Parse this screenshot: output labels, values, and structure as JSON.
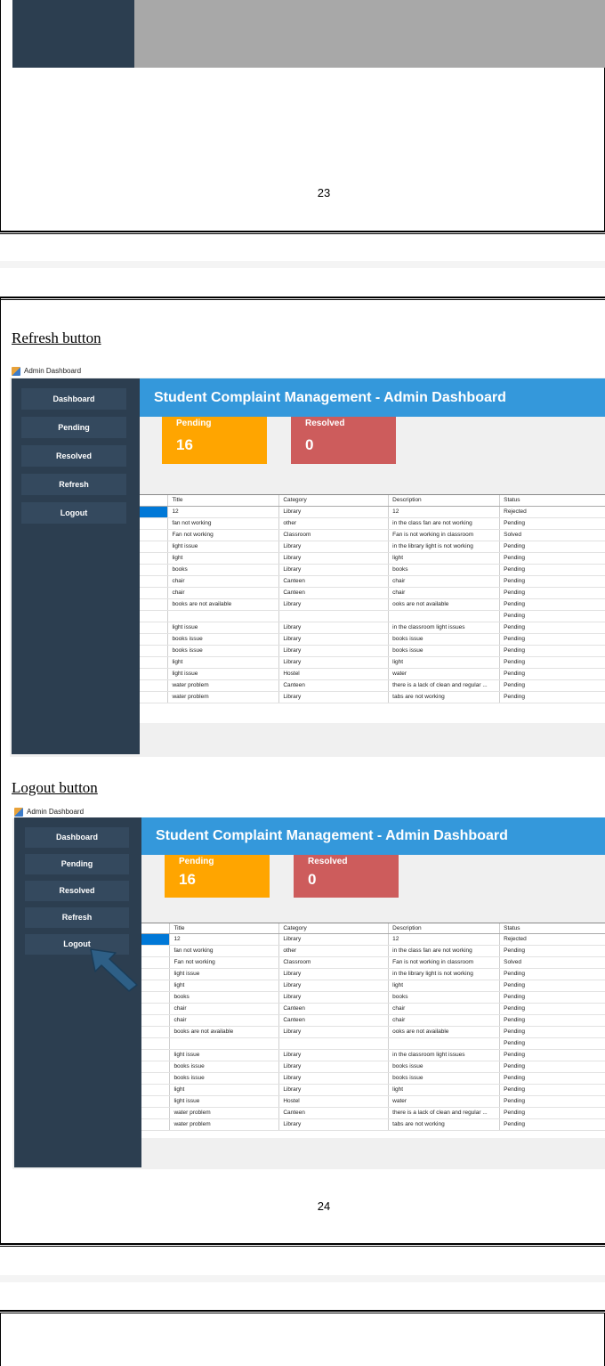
{
  "page_top": {
    "page_number": "23"
  },
  "page_main": {
    "refresh_heading": "Refresh button",
    "logout_heading": "Logout button",
    "page_number": "24"
  },
  "screens": [
    {
      "window_title": "Admin Dashboard",
      "banner": "Student Complaint Management - Admin Dashboard",
      "nav": [
        "Dashboard",
        "Pending",
        "Resolved",
        "Refresh",
        "Logout"
      ],
      "cards": [
        {
          "label": "Pending",
          "value": "16",
          "color": "#ffa500"
        },
        {
          "label": "Resolved",
          "value": "0",
          "color": "#cd5c5c"
        }
      ]
    },
    {
      "window_title": "Admin Dashboard",
      "banner": "Student Complaint Management - Admin Dashboard",
      "nav": [
        "Dashboard",
        "Pending",
        "Resolved",
        "Refresh",
        "Logout"
      ],
      "cards": [
        {
          "label": "Pending",
          "value": "16",
          "color": "#ffa500"
        },
        {
          "label": "Resolved",
          "value": "0",
          "color": "#cd5c5c"
        }
      ]
    }
  ],
  "table": {
    "columns": [
      "Title",
      "Category",
      "Description",
      "Status"
    ],
    "rows": [
      [
        "12",
        "Library",
        "12",
        "Rejected"
      ],
      [
        "fan not working",
        "other",
        "in the class fan are not working",
        "Pending"
      ],
      [
        "Fan not working",
        "Classroom",
        "Fan is not working in classroom",
        "Solved"
      ],
      [
        "light issue",
        "Library",
        "in the library light is not working",
        "Pending"
      ],
      [
        "light",
        "Library",
        "light",
        "Pending"
      ],
      [
        "books",
        "Library",
        "books",
        "Pending"
      ],
      [
        "chair",
        "Canteen",
        "chair",
        "Pending"
      ],
      [
        "chair",
        "Canteen",
        "chair",
        "Pending"
      ],
      [
        "books are not available",
        "Library",
        "ooks are not available",
        "Pending"
      ],
      [
        "",
        "",
        "",
        "Pending"
      ],
      [
        "light issue",
        "Library",
        "in the classroom light issues",
        "Pending"
      ],
      [
        "books issue",
        "Library",
        "books issue",
        "Pending"
      ],
      [
        "books issue",
        "Library",
        "books issue",
        "Pending"
      ],
      [
        "light",
        "Library",
        "light",
        "Pending"
      ],
      [
        "light issue",
        "Hostel",
        "water",
        "Pending"
      ],
      [
        "water problem",
        "Canteen",
        "there is a lack of clean and regular ...",
        "Pending"
      ],
      [
        "water problem",
        "Library",
        "tabs are not working",
        "Pending"
      ]
    ]
  },
  "colors": {
    "sidebar": "#2c3e50",
    "nav_button": "#34495e",
    "banner": "#3498db",
    "arrow": "#2e5f86"
  }
}
